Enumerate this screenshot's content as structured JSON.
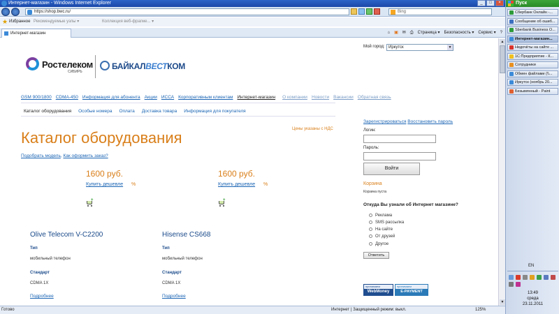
{
  "browser": {
    "title": "Интернет-магазин - Windows Internet Explorer",
    "url": "https://shop.bwc.ru/",
    "search_placeholder": "Bing",
    "favorites_label": "Избранное",
    "favbar_items": [
      "Рекомендуемые узлы ▾",
      "Коллекция веб-фрагме... ▾"
    ],
    "tab_title": "Интернет-магазин",
    "command_bar": [
      "Страница ▾",
      "Безопасность ▾",
      "Сервис ▾"
    ],
    "status": "Готово",
    "zone": "Интернет | Защищенный режим: выкл.",
    "zoom": "125%"
  },
  "page": {
    "city_label": "Мой город:",
    "city_value": "Иркутск",
    "logo_rostelecom": "Ростелеком",
    "logo_rostelecom_sub": "СИБИРЬ",
    "logo_baikal_a": "БАЙКАЛ",
    "logo_baikal_b": "ВЕСТ",
    "logo_baikal_c": "КОМ",
    "main_nav": [
      {
        "label": "GSM 900/1800"
      },
      {
        "label": "CDMA-450"
      },
      {
        "label": "Информация для абонента"
      },
      {
        "label": "Акции"
      },
      {
        "label": "ИССА"
      },
      {
        "label": "Корпоративным клиентам"
      },
      {
        "label": "Интернет-магазин"
      },
      {
        "label": "О компании"
      },
      {
        "label": "Новости"
      },
      {
        "label": "Вакансии"
      },
      {
        "label": "Обратная связь"
      }
    ],
    "sub_nav": [
      {
        "label": "Каталог оборудования"
      },
      {
        "label": "Особые номера"
      },
      {
        "label": "Оплата"
      },
      {
        "label": "Доставка товара"
      },
      {
        "label": "Информация для покупателя"
      }
    ],
    "heading": "Каталог оборудования",
    "price_note": "Цены указаны с НДС",
    "help_link_1": "Подобрать модель",
    "help_link_2": "Как оформить заказ?",
    "products": [
      {
        "price": "1600 руб.",
        "cheaper": "Купить дешевле",
        "pct": "%",
        "name": "Olive Telecom V-C2200",
        "type_label": "Тип",
        "type": "мобильный телефон",
        "std_label": "Стандарт",
        "std": "CDMA 1X",
        "more": "Подробнее"
      },
      {
        "price": "1600 руб.",
        "cheaper": "Купить дешевле",
        "pct": "%",
        "name": "Hisense CS668",
        "type_label": "Тип",
        "type": "мобильный телефон",
        "std_label": "Стандарт",
        "std": "CDMA 1X",
        "more": "Подробнее"
      }
    ],
    "auth": {
      "register": "Зарегистрироваться",
      "restore": "Восстановить пароль",
      "login_label": "Логин:",
      "password_label": "Пароль:",
      "login_button": "Войти"
    },
    "cart": {
      "title": "Корзина",
      "empty": "Корзина пуста"
    },
    "poll": {
      "question": "Откуда Вы узнали об Интернет магазине?",
      "options": [
        "Реклама",
        "SMS рассылка",
        "На сайте",
        "От друзей",
        "Другое"
      ],
      "button": "Ответить"
    },
    "payments": {
      "wm_top": "принимаем",
      "wm_name": "WebMoney",
      "ep_top": "принимаем",
      "ep_name": "E-PAYMENT"
    }
  },
  "taskbar": {
    "start": "Пуск",
    "items": [
      {
        "label": "Сбербанк Онлайн -...",
        "color": "#2e9b3a"
      },
      {
        "label": "Сообщение об ошиб...",
        "color": "#3b6fc0"
      },
      {
        "label": "Sberbank Business O...",
        "color": "#2e9b3a"
      },
      {
        "label": "Интернет-магазин...",
        "color": "#3b8ad8",
        "active": true
      },
      {
        "label": "Недочёты на сайте ...",
        "color": "#d9342b"
      },
      {
        "label": "1С:Предприятие - К...",
        "color": "#f0c020"
      },
      {
        "label": "Сотрудники",
        "color": "#e89020"
      },
      {
        "label": "Обмен файлами (\\\\...",
        "color": "#3b8ad8"
      },
      {
        "label": "Иркутск (ноябрь 20...",
        "color": "#3b8ad8"
      },
      {
        "label": "Безымянный - Paint",
        "color": "#e06030"
      }
    ],
    "lang": "EN",
    "time": "13:49",
    "weekday": "среда",
    "date": "23.11.2011"
  }
}
